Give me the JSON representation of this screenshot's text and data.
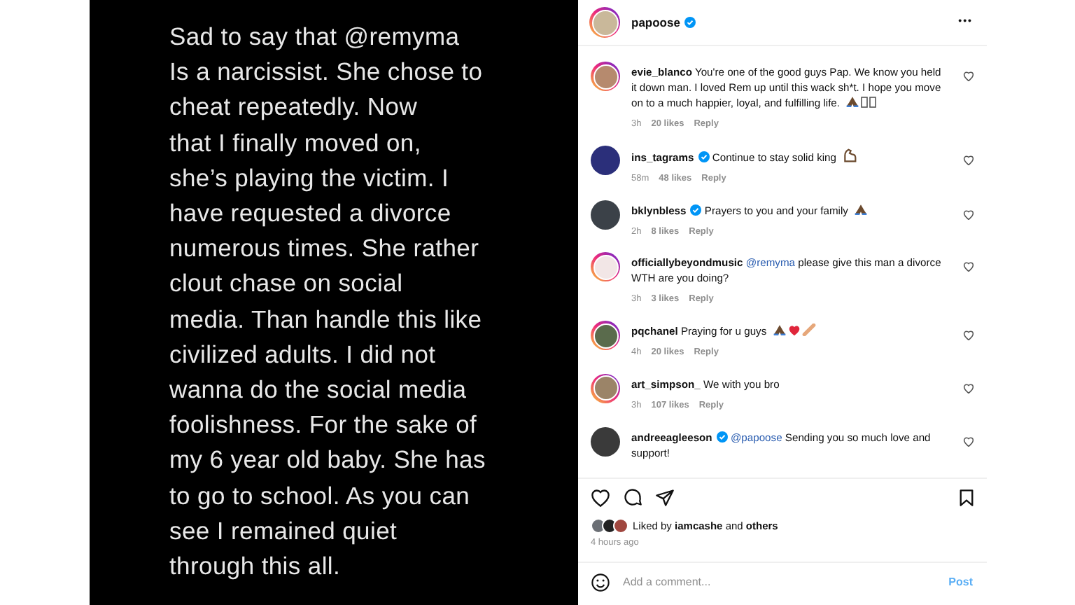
{
  "story": {
    "lines": [
      "Sad to say that @remyma",
      "Is a narcissist. She chose to",
      "cheat repeatedly. Now",
      "that I finally moved on,",
      "she’s playing the victim. I",
      "have requested a divorce",
      "numerous times. She rather",
      "clout chase on social",
      "media. Than handle this like",
      "civilized adults. I did not",
      "wanna do the social media",
      "foolishness. For the sake of",
      "my 6 year old baby. She has",
      "to go to school. As you can",
      "see I remained quiet",
      "through this all."
    ]
  },
  "header": {
    "username": "papoose",
    "verified": true,
    "more": "•••"
  },
  "comments": [
    {
      "username": "evie_blanco",
      "verified": false,
      "text": "You're one of the good guys Pap. We know you held it down man. I loved Rem up until this wack sh*t. I hope you move on to a much happier, loyal, and fulfilling life.",
      "emojis": [
        {
          "kind": "pray"
        },
        {
          "kind": "missing"
        },
        {
          "kind": "missing"
        }
      ],
      "time": "3h",
      "likes": "20 likes",
      "reply": "Reply",
      "ring": true
    },
    {
      "username": "ins_tagrams",
      "verified": true,
      "text": "Continue to stay solid king",
      "emojis": [
        {
          "kind": "muscle"
        }
      ],
      "time": "58m",
      "likes": "48 likes",
      "reply": "Reply",
      "ring": false
    },
    {
      "username": "bklynbless",
      "verified": true,
      "text": "Prayers to you and your family",
      "emojis": [
        {
          "kind": "pray"
        }
      ],
      "time": "2h",
      "likes": "8 likes",
      "reply": "Reply",
      "ring": false
    },
    {
      "username": "officiallybeyondmusic",
      "verified": false,
      "mention": "@remyma",
      "text": "please give this man a divorce WTH are you doing?",
      "time": "3h",
      "likes": "3 likes",
      "reply": "Reply",
      "ring": true
    },
    {
      "username": "pqchanel",
      "verified": false,
      "text": "Praying for u guys",
      "emojis": [
        {
          "kind": "pray"
        },
        {
          "kind": "heart"
        },
        {
          "kind": "bandage"
        }
      ],
      "time": "4h",
      "likes": "20 likes",
      "reply": "Reply",
      "ring": true
    },
    {
      "username": "art_simpson_",
      "verified": false,
      "text": "We with you bro",
      "time": "3h",
      "likes": "107 likes",
      "reply": "Reply",
      "ring": true
    },
    {
      "username": "andreeagleeson",
      "verified": true,
      "mention": "@papoose",
      "text": "Sending you so much love and support!",
      "ring": false
    }
  ],
  "likes": {
    "text": "Liked by **iamcashe** and **others**",
    "time": "4 hours ago"
  },
  "comment_box": {
    "placeholder": "Add a comment...",
    "post": "Post",
    "disabled": true
  }
}
